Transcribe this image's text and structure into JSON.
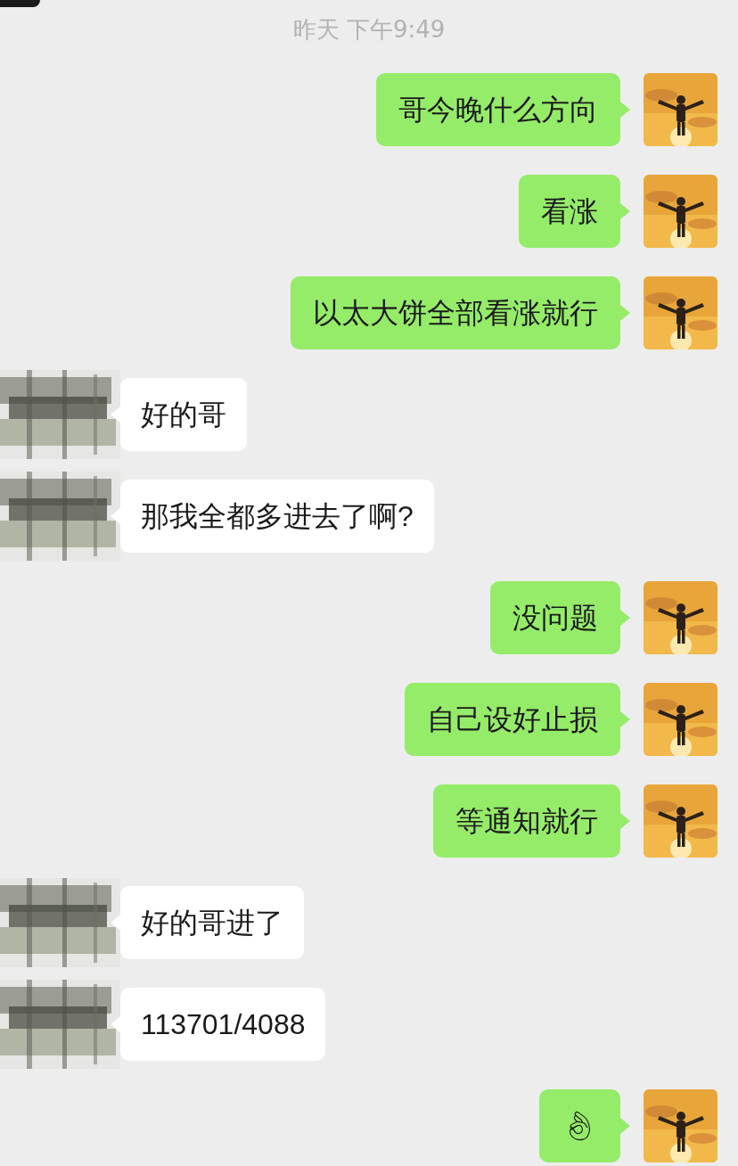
{
  "timestamp": "昨天 下午9:49",
  "messages": [
    {
      "kind": "outgoing",
      "text": "哥今晚什么方向"
    },
    {
      "kind": "outgoing",
      "text": "看涨"
    },
    {
      "kind": "outgoing",
      "text": "以太大饼全部看涨就行"
    },
    {
      "kind": "incoming",
      "text": "好的哥"
    },
    {
      "kind": "incoming",
      "text": "那我全都多进去了啊?"
    },
    {
      "kind": "outgoing",
      "text": "没问题"
    },
    {
      "kind": "outgoing",
      "text": "自己设好止损"
    },
    {
      "kind": "outgoing",
      "text": "等通知就行"
    },
    {
      "kind": "incoming",
      "text": "好的哥进了"
    },
    {
      "kind": "incoming",
      "text": "113701/4088"
    },
    {
      "kind": "outgoing",
      "text": "👌"
    }
  ]
}
